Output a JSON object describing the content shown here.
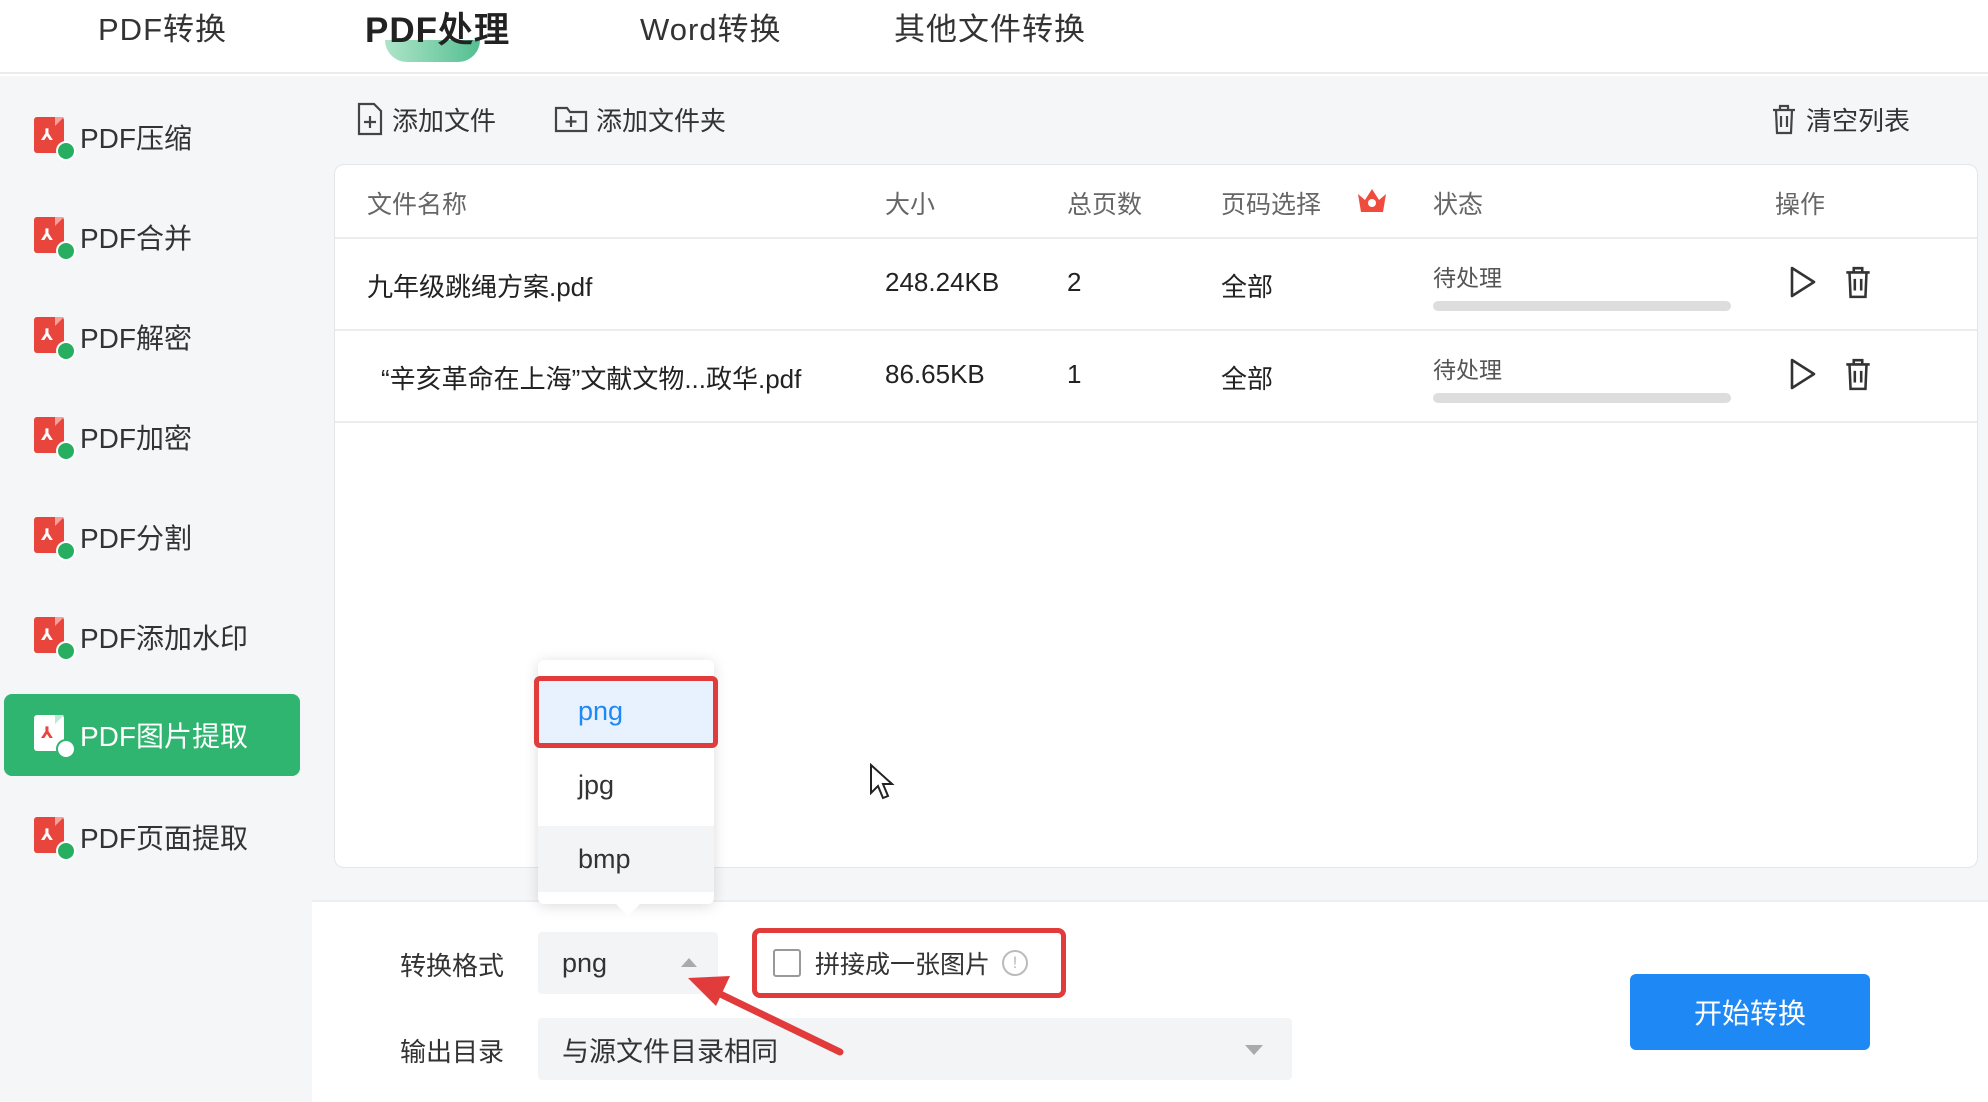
{
  "top_tabs": [
    {
      "label": "PDF转换"
    },
    {
      "label": "PDF处理"
    },
    {
      "label": "Word转换"
    },
    {
      "label": "其他文件转换"
    }
  ],
  "sidebar": {
    "items": [
      {
        "label": "PDF压缩"
      },
      {
        "label": "PDF合并"
      },
      {
        "label": "PDF解密"
      },
      {
        "label": "PDF加密"
      },
      {
        "label": "PDF分割"
      },
      {
        "label": "PDF添加水印"
      },
      {
        "label": "PDF图片提取",
        "active": true
      },
      {
        "label": "PDF页面提取"
      }
    ]
  },
  "toolbar": {
    "add_file": "添加文件",
    "add_folder": "添加文件夹",
    "clear_list": "清空列表"
  },
  "table": {
    "columns": [
      "文件名称",
      "大小",
      "总页数",
      "页码选择",
      "状态",
      "操作"
    ],
    "rows": [
      {
        "name": "九年级跳绳方案.pdf",
        "size": "248.24KB",
        "pages": "2",
        "page_select": "全部",
        "status": "待处理",
        "progress": 0
      },
      {
        "name": "“辛亥革命在上海”文献文物...政华.pdf",
        "size": "86.65KB",
        "pages": "1",
        "page_select": "全部",
        "status": "待处理",
        "progress": 0
      }
    ]
  },
  "settings": {
    "format_label": "转换格式",
    "format_value": "png",
    "format_options": [
      "png",
      "jpg",
      "bmp"
    ],
    "merge_label": "拼接成一张图片",
    "output_label": "输出目录",
    "output_value": "与源文件目录相同",
    "start_button": "开始转换"
  },
  "colors": {
    "accent_green": "#2fb56f",
    "primary_blue": "#1e88f5",
    "highlight_red": "#e23b3b",
    "pdf_red": "#e8453c"
  }
}
